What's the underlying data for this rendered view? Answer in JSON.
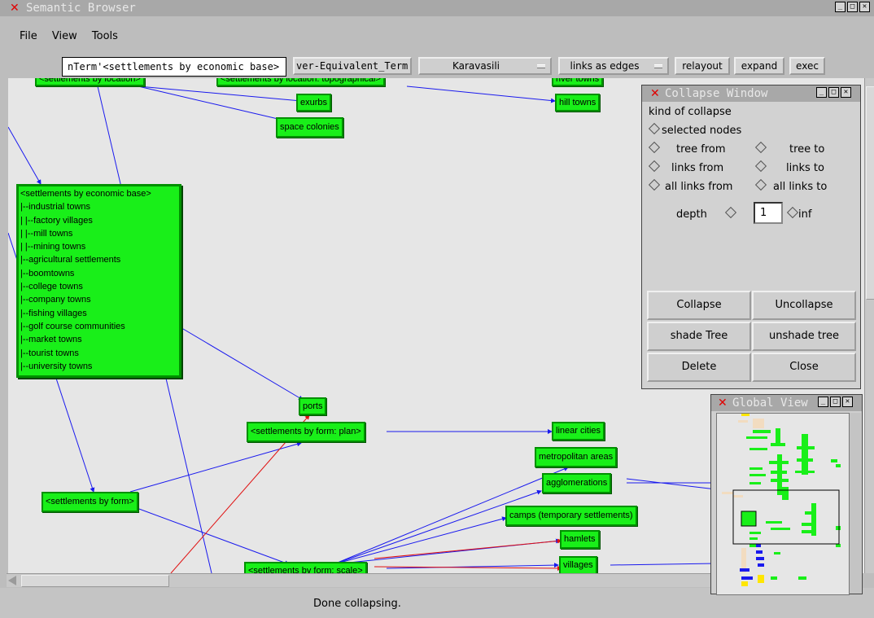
{
  "window": {
    "title": "Semantic Browser"
  },
  "menu": [
    "File",
    "View",
    "Tools"
  ],
  "toolbar": {
    "term_value": "nTerm'<settlements by economic base>",
    "equiv_value": "ver-Equivalent_Term",
    "user_select": "Karavasili",
    "mode_select": "links as edges",
    "relayout": "relayout",
    "expand": "expand",
    "exec": "exec"
  },
  "nodes": [
    {
      "label": "<settlements by location>"
    },
    {
      "label": "<settlements by location: topographical>"
    },
    {
      "label": "river towns"
    },
    {
      "label": "exurbs"
    },
    {
      "label": "hill towns"
    },
    {
      "label": "space colonies"
    },
    {
      "label": "ports"
    },
    {
      "label": "<settlements by form: plan>"
    },
    {
      "label": "linear cities"
    },
    {
      "label": "metropolitan areas"
    },
    {
      "label": "agglomerations"
    },
    {
      "label": "<settlements by form>"
    },
    {
      "label": "camps (temporary settlements)"
    },
    {
      "label": "hamlets"
    },
    {
      "label": "villages"
    },
    {
      "label": "<settlements by form: scale>"
    }
  ],
  "economic_base": {
    "title": "<settlements by economic base>",
    "items": [
      "|--industrial towns",
      "|  |--factory villages",
      "|  |--mill towns",
      "|  |--mining towns",
      "|--agricultural settlements",
      "|--boomtowns",
      "|--college towns",
      "|--company towns",
      "|--fishing villages",
      "|--golf course communities",
      "|--market towns",
      "|--tourist towns",
      "|--university towns"
    ]
  },
  "collapse": {
    "title": "Collapse Window",
    "kind_label": "kind of collapse",
    "selected_nodes": "selected nodes",
    "tree_from": "tree from",
    "tree_to": "tree to",
    "links_from": "links from",
    "links_to": "links to",
    "all_links_from": "all links from",
    "all_links_to": "all links to",
    "depth_label": "depth",
    "depth_value": "1",
    "inf_label": "inf",
    "buttons": {
      "collapse": "Collapse",
      "uncollapse": "Uncollapse",
      "shade": "shade Tree",
      "unshade": "unshade tree",
      "delete": "Delete",
      "close": "Close"
    }
  },
  "global_view": {
    "title": "Global View"
  },
  "status": {
    "text": "Done collapsing."
  },
  "colors": {
    "node": "#19ef19",
    "edge": "#1a1aee",
    "edge_red": "#e01010",
    "canvas": "#e6e6e6"
  }
}
